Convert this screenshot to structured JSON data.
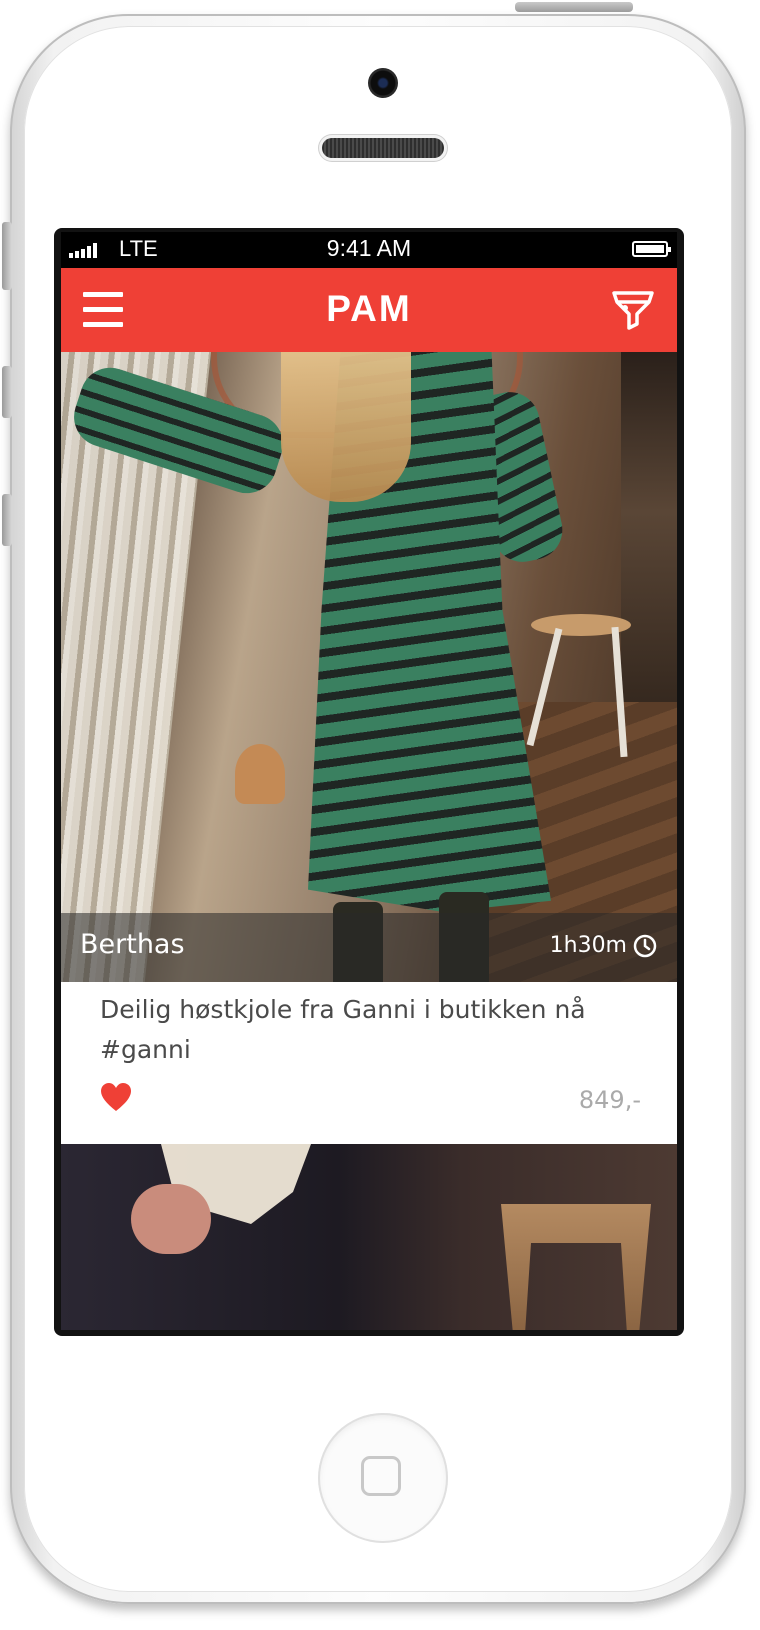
{
  "status_bar": {
    "carrier": "LTE",
    "time": "9:41 AM"
  },
  "header": {
    "title": "PAM",
    "menu_icon": "hamburger-menu-icon",
    "filter_icon": "filter-funnel-icon"
  },
  "feed": {
    "posts": [
      {
        "author": "Berthas",
        "time_ago": "1h30m",
        "time_icon": "clock-icon",
        "caption": "Deilig høstkjole fra Ganni i butikken nå #ganni",
        "liked": true,
        "like_icon": "heart-icon",
        "price": "849,-"
      }
    ]
  },
  "colors": {
    "accent": "#ef4036",
    "caption_text": "#4a4a4a",
    "price_text": "#aaaaaa"
  }
}
